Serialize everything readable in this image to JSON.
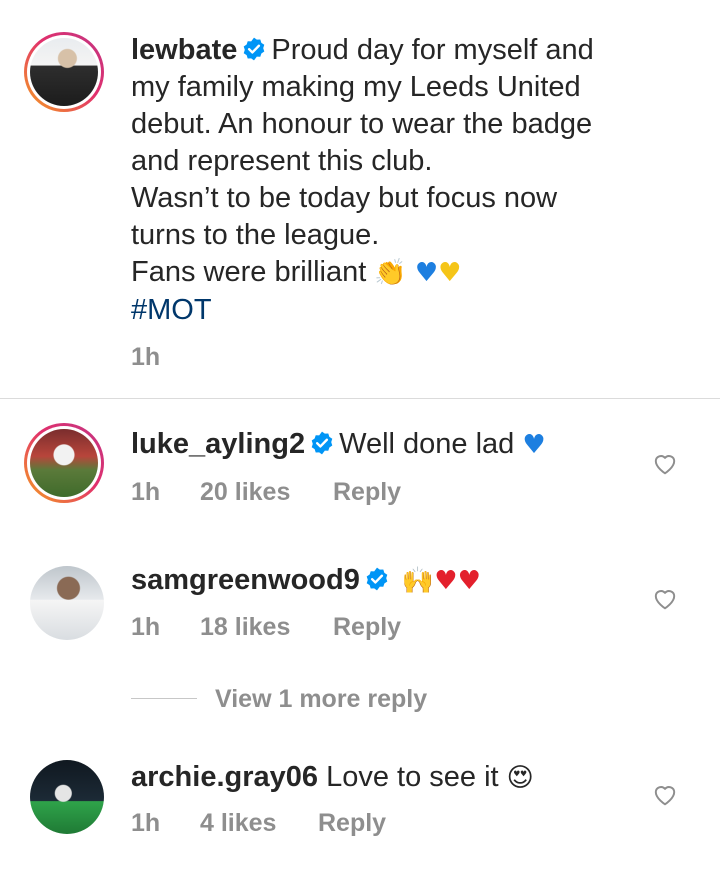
{
  "caption": {
    "username": "lewbate",
    "lines": [
      "Proud day for myself and",
      "my family making my Leeds United",
      "debut. An honour to wear the badge",
      "and represent this club.",
      "Wasn’t to be today but focus now",
      "turns to the league.",
      "Fans were brilliant"
    ],
    "hashtag": "#MOT",
    "time": "1h"
  },
  "comments": [
    {
      "username": "luke_ayling2",
      "text": "Well done lad",
      "time": "1h",
      "likes": "20 likes",
      "reply": "Reply"
    },
    {
      "username": "samgreenwood9",
      "text": "",
      "time": "1h",
      "likes": "18 likes",
      "reply": "Reply"
    },
    {
      "username": "archie.gray06",
      "text": "Love to see it",
      "time": "1h",
      "likes": "4 likes",
      "reply": "Reply"
    }
  ],
  "view_more": "View 1 more reply",
  "colors": {
    "text": "#262626",
    "muted": "#8e8e8e",
    "link": "#00376b",
    "verified": "#0095f6"
  },
  "icons": [
    "verified-badge-icon",
    "heart-outline-icon",
    "clapping-hands-emoji",
    "blue-heart-emoji",
    "yellow-heart-emoji",
    "raised-hands-emoji",
    "red-heart-emoji",
    "heart-eyes-emoji"
  ]
}
